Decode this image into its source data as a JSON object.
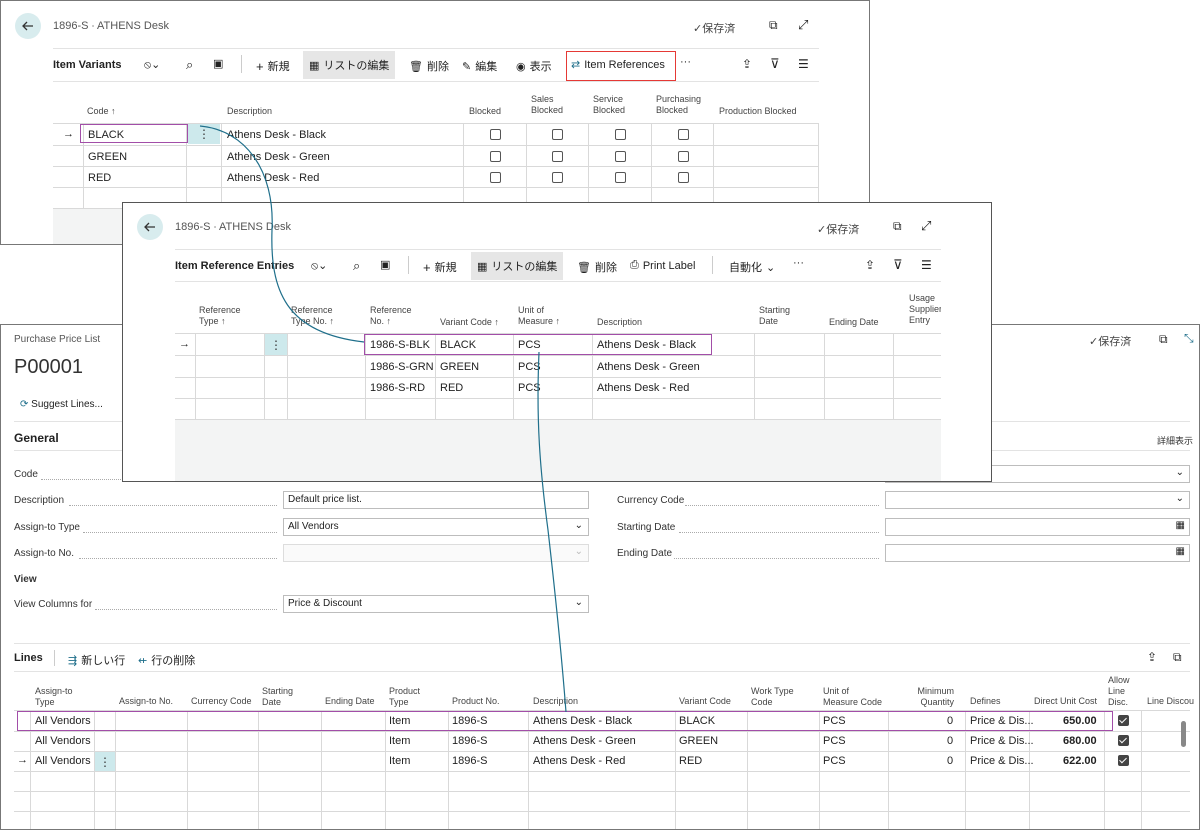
{
  "variants_window": {
    "title": "1896-S ∙ ATHENS Desk",
    "saved": "保存済",
    "page_title": "Item Variants",
    "actions": [
      "新規",
      "リストの編集",
      "削除",
      "編集",
      "表示",
      "Item References"
    ],
    "columns": [
      "Code ↑",
      "Description",
      "Blocked",
      "Sales Blocked",
      "Service Blocked",
      "Purchasing Blocked",
      "Production Blocked"
    ],
    "rows": [
      {
        "code": "BLACK",
        "description": "Athens Desk - Black"
      },
      {
        "code": "GREEN",
        "description": "Athens Desk - Green"
      },
      {
        "code": "RED",
        "description": "Athens Desk - Red"
      }
    ]
  },
  "references_window": {
    "title": "1896-S ∙ ATHENS Desk",
    "saved": "保存済",
    "page_title": "Item Reference Entries",
    "actions": [
      "新規",
      "リストの編集",
      "削除",
      "Print Label",
      "自動化"
    ],
    "columns": [
      "Reference Type ↑",
      "Reference Type No. ↑",
      "Reference No. ↑",
      "Variant Code ↑",
      "Unit of Measure ↑",
      "Description",
      "Starting Date",
      "Ending Date",
      "Usage Supplier Entry"
    ],
    "rows": [
      {
        "ref_no": "1986-S-BLK",
        "variant": "BLACK",
        "uom": "PCS",
        "description": "Athens Desk - Black"
      },
      {
        "ref_no": "1986-S-GRN",
        "variant": "GREEN",
        "uom": "PCS",
        "description": "Athens Desk - Green"
      },
      {
        "ref_no": "1986-S-RD",
        "variant": "RED",
        "uom": "PCS",
        "description": "Athens Desk - Red"
      }
    ]
  },
  "price_window": {
    "breadcrumb": "Purchase Price List",
    "record": "P00001",
    "saved": "保存済",
    "suggest": "Suggest Lines...",
    "general": "General",
    "show_more": "詳細表示",
    "fields": {
      "code": "Code",
      "description": "Description",
      "description_value": "Default price list.",
      "assign_to_type": "Assign-to Type",
      "assign_to_type_value": "All Vendors",
      "assign_to_no": "Assign-to No.",
      "currency_code": "Currency Code",
      "starting_date": "Starting Date",
      "ending_date": "Ending Date",
      "view": "View",
      "view_columns_for": "View Columns for",
      "view_columns_value": "Price & Discount"
    },
    "lines_title": "Lines",
    "new_line": "新しい行",
    "delete_line": "行の削除",
    "columns": [
      "Assign-to Type",
      "Assign-to No.",
      "Currency Code",
      "Starting Date",
      "Ending Date",
      "Product Type",
      "Product No.",
      "Description",
      "Variant Code",
      "Work Type Code",
      "Unit of Measure Code",
      "Minimum Quantity",
      "Defines",
      "Direct Unit Cost",
      "Allow Line Disc.",
      "Line Discou"
    ],
    "rows": [
      {
        "type": "All Vendors",
        "ptype": "Item",
        "pno": "1896-S",
        "desc": "Athens Desk - Black",
        "variant": "BLACK",
        "uom": "PCS",
        "minq": "0",
        "defines": "Price & Dis...",
        "cost": "650.00"
      },
      {
        "type": "All Vendors",
        "ptype": "Item",
        "pno": "1896-S",
        "desc": "Athens Desk - Green",
        "variant": "GREEN",
        "uom": "PCS",
        "minq": "0",
        "defines": "Price & Dis...",
        "cost": "680.00"
      },
      {
        "type": "All Vendors",
        "ptype": "Item",
        "pno": "1896-S",
        "desc": "Athens Desk - Red",
        "variant": "RED",
        "uom": "PCS",
        "minq": "0",
        "defines": "Price & Dis...",
        "cost": "622.00"
      }
    ]
  },
  "colors": {
    "highlight": "#a24ea8",
    "callout": "#e53935",
    "connector": "#1f6f8b",
    "accent": "#cde9ec"
  }
}
